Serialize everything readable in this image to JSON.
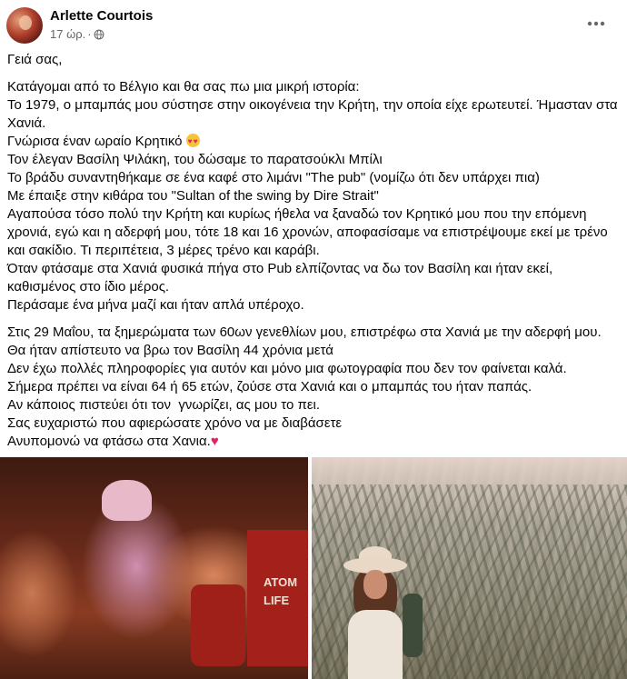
{
  "author": {
    "name": "Arlette Courtois",
    "time": "17 ώρ.",
    "privacy_icon": "globe-icon"
  },
  "more_icon": "more-horizontal-icon",
  "post": {
    "greeting": "Γειά σας,",
    "paragraph1": [
      "Κατάγομαι από το Βέλγιο και θα σας πω μια μικρή ιστορία:",
      "Το 1979, ο μπαμπάς μου σύστησε στην οικογένεια την Κρήτη, την οποία είχε ερωτευτεί. Ήμασταν στα Χανιά.",
      "Γνώρισα έναν ωραίο Κρητικό",
      "Τον έλεγαν Βασίλη Ψιλάκη, του δώσαμε το παρατσούκλι Μπίλι",
      "Το βράδυ συναντηθήκαμε σε ένα καφέ στο λιμάνι \"The pub\" (νομίζω ότι δεν υπάρχει πια)",
      "Με έπαιξε στην κιθάρα του \"Sultan of the swing by Dire Strait\"",
      "Αγαπούσα τόσο πολύ την Κρήτη και κυρίως ήθελα να ξαναδώ τον Κρητικό μου που την επόμενη χρονιά, εγώ και η αδερφή μου, τότε 18 και 16 χρονών, αποφασίσαμε να επιστρέψουμε εκεί με τρένο και σακίδιο. Τι περιπέτεια, 3 μέρες τρένο και καράβι.",
      "Όταν φτάσαμε στα Χανιά φυσικά πήγα στο Pub ελπίζοντας να δω τον Βασίλη και ήταν εκεί, καθισμένος στο ίδιο μέρος.",
      "Περάσαμε ένα μήνα μαζί και ήταν απλά υπέροχο."
    ],
    "paragraph2": [
      "Στις 29 Μαΐου, τα ξημερώματα των 60ων γενεθλίων μου, επιστρέφω στα Χανιά με την αδερφή μου. Θα ήταν απίστευτο να βρω τον Βασίλη 44 χρόνια μετά",
      "Δεν έχω πολλές πληροφορίες για αυτόν και μόνο μια φωτογραφία που δεν τον φαίνεται καλά.",
      "Σήμερα πρέπει να είναι 64 ή 65 ετών, ζούσε στα Χανιά και ο μπαμπάς του ήταν παπάς.",
      "Αν κάποιος πιστεύει ότι τον  γνωρίζει, ας μου το πει.",
      "Σας ευχαριστώ που αφιερώσατε χρόνο να με διαβάσετε",
      "Ανυπομονώ να φτάσω στα Χανια."
    ],
    "emoji_after_line3": "heart-eyes-emoji",
    "emoji_after_last": "red-heart-emoji"
  },
  "photos": {
    "left_shirt_text_line1": "ATOM",
    "left_shirt_text_line2": "LIFE"
  }
}
